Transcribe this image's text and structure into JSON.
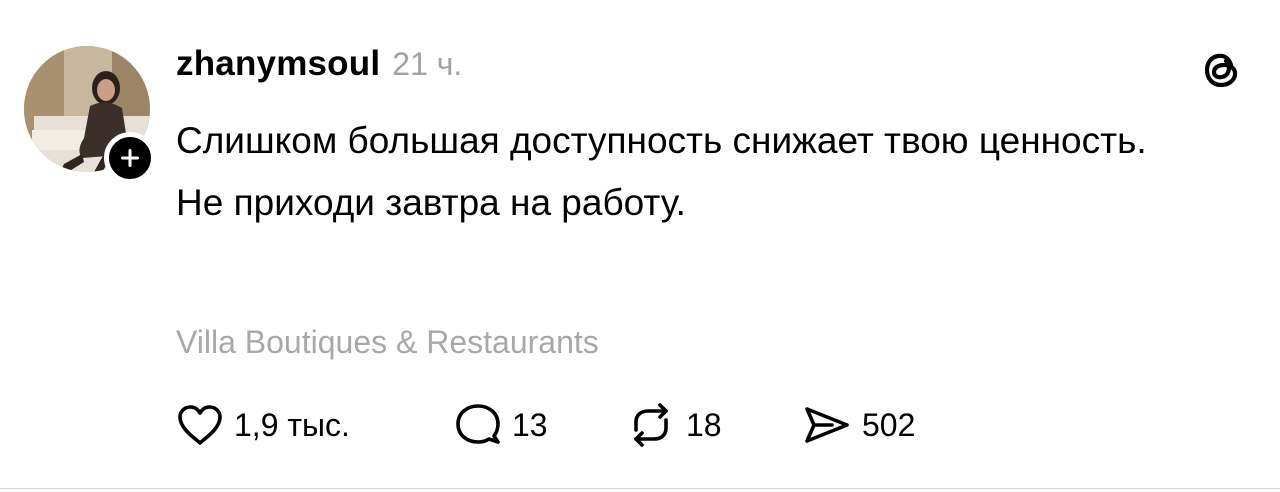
{
  "post": {
    "username": "zhanymsoul",
    "time": "21 ч.",
    "paragraphs": [
      "Слишком большая доступность снижает твою ценность.",
      "Не приходи завтра на работу."
    ],
    "location": "Villa Boutiques & Restaurants",
    "avatar": {
      "icon": "user-avatar-photo",
      "follow_icon": "plus-icon"
    },
    "app_icon": "threads-logo-icon"
  },
  "actions": {
    "like": {
      "icon": "heart-icon",
      "count": "1,9 тыс."
    },
    "reply": {
      "icon": "comment-icon",
      "count": "13"
    },
    "repost": {
      "icon": "repost-icon",
      "count": "18"
    },
    "share": {
      "icon": "send-icon",
      "count": "502"
    }
  },
  "colors": {
    "text": "#000000",
    "muted": "#a3a3a3",
    "background": "#ffffff"
  }
}
